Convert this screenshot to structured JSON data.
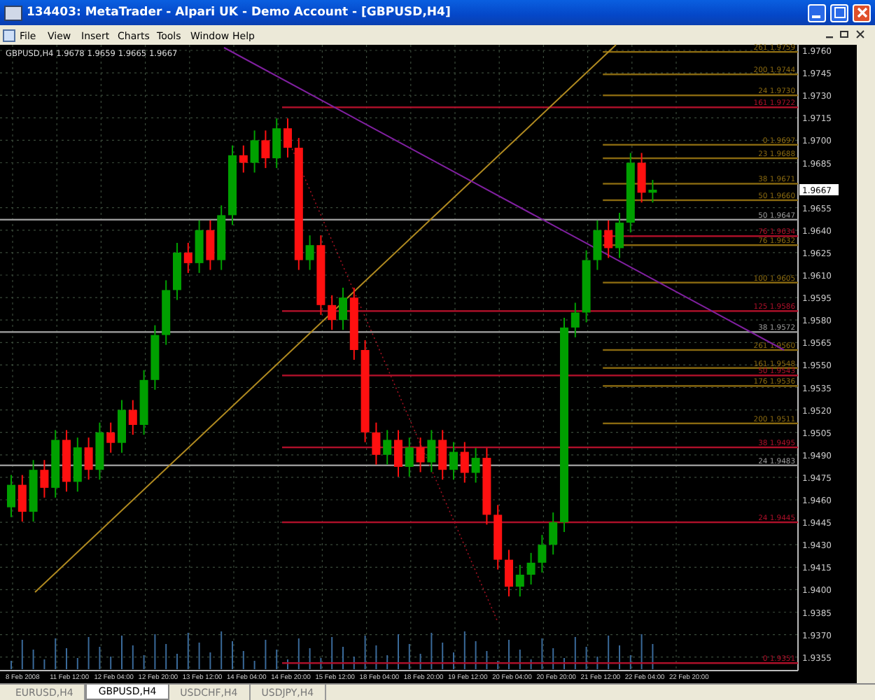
{
  "window": {
    "title": "134403: MetaTrader - Alpari UK - Demo Account - [GBPUSD,H4]"
  },
  "menu": [
    "File",
    "View",
    "Insert",
    "Charts",
    "Tools",
    "Window",
    "Help"
  ],
  "chart": {
    "title": "GBPUSD,H4  1.9678 1.9659 1.9665 1.9667",
    "price_scale": [
      "1.9760",
      "1.9745",
      "1.9730",
      "1.9715",
      "1.9700",
      "1.9685",
      "1.9655",
      "1.9640",
      "1.9625",
      "1.9610",
      "1.9595",
      "1.9580",
      "1.9565",
      "1.9550",
      "1.9535",
      "1.9520",
      "1.9505",
      "1.9490",
      "1.9475",
      "1.9460",
      "1.9445",
      "1.9430",
      "1.9415",
      "1.9400",
      "1.9385",
      "1.9370",
      "1.9355"
    ],
    "time_scale": [
      "8 Feb 2008",
      "11 Feb 12:00",
      "12 Feb 04:00",
      "12 Feb 20:00",
      "13 Feb 12:00",
      "14 Feb 04:00",
      "14 Feb 20:00",
      "15 Feb 12:00",
      "18 Feb 04:00",
      "18 Feb 20:00",
      "19 Feb 12:00",
      "20 Feb 04:00",
      "20 Feb 20:00",
      "21 Feb 12:00",
      "22 Feb 04:00",
      "22 Feb 20:00"
    ],
    "levels": [
      {
        "label": "261 1.9759",
        "color": "#8a6a10"
      },
      {
        "label": "200 1.9744",
        "color": "#8a6a10"
      },
      {
        "label": "24 1.9730",
        "color": "#8a6a10"
      },
      {
        "label": "161 1.9722",
        "color": "#b0102a"
      },
      {
        "label": "0 1.9697",
        "color": "#8a6a10"
      },
      {
        "label": "23 1.9688",
        "color": "#8a6a10"
      },
      {
        "label": "38 1.9671",
        "color": "#8a6a10"
      },
      {
        "label": "50 1.9660",
        "color": "#8a6a10"
      },
      {
        "label": "50 1.9647",
        "color": "#9a9a9a"
      },
      {
        "label": "76 1.9634",
        "color": "#b0102a"
      },
      {
        "label": "76 1.9632",
        "color": "#8a6a10"
      },
      {
        "label": "100 1.9605",
        "color": "#8a6a10"
      },
      {
        "label": "125 1.9586",
        "color": "#b0102a"
      },
      {
        "label": "38 1.9572",
        "color": "#9a9a9a"
      },
      {
        "label": "261 1.9560",
        "color": "#8a6a10"
      },
      {
        "label": "161 1.9548",
        "color": "#8a6a10"
      },
      {
        "label": "50 1.9543",
        "color": "#b0102a"
      },
      {
        "label": "176 1.9536",
        "color": "#8a6a10"
      },
      {
        "label": "200 1.9511",
        "color": "#8a6a10"
      },
      {
        "label": "38 1.9495",
        "color": "#b0102a"
      },
      {
        "label": "24 1.9483",
        "color": "#9a9a9a"
      },
      {
        "label": "24 1.9445",
        "color": "#b0102a"
      },
      {
        "label": "0 1.9351",
        "color": "#b0102a"
      }
    ],
    "current_price": "1.9667"
  },
  "tabs": [
    {
      "label": "EURUSD,H4",
      "selected": false
    },
    {
      "label": "GBPUSD,H4",
      "selected": true
    },
    {
      "label": "USDCHF,H4",
      "selected": false
    },
    {
      "label": "USDJPY,H4",
      "selected": false
    }
  ]
}
